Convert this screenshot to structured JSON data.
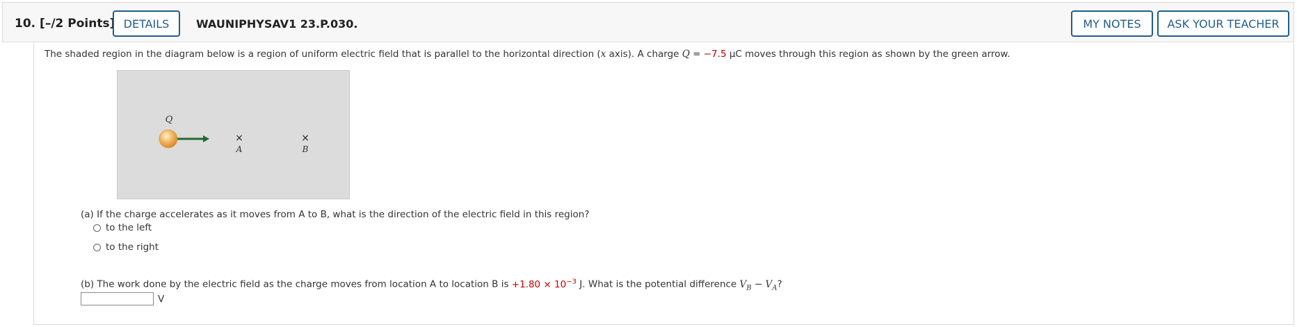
{
  "header": {
    "question_number": "10.",
    "points": "[–/2 Points]",
    "details_label": "DETAILS",
    "question_code": "WAUNIPHYSAV1 23.P.030.",
    "my_notes_label": "MY NOTES",
    "ask_teacher_label": "ASK YOUR TEACHER"
  },
  "intro": {
    "text_before": "The shaded region in the diagram below is a region of uniform electric field that is parallel to the horizontal direction (",
    "axis_var": "x",
    "text_axis": " axis). A charge ",
    "charge_var": "Q",
    "equals": " = ",
    "charge_value": "−7.5",
    "charge_unit": " µC",
    "text_after": "  moves through this region as shown by the green arrow."
  },
  "diagram": {
    "charge_label": "Q",
    "point_a_label": "A",
    "point_b_label": "B",
    "marker": "×",
    "arrow_color": "#1e6b2e",
    "charge_color": "#f2b35a",
    "region_color": "#dcdcdc"
  },
  "part_a": {
    "prompt": "(a) If the charge accelerates as it moves from A to B, what is the direction of the electric field in this region?",
    "options": [
      "to the left",
      "to the right"
    ]
  },
  "part_b": {
    "prompt_before": "(b) The work done by the electric field as the charge moves from location A to location B is ",
    "work_value": "+1.80 × 10",
    "work_exponent": "−3",
    "prompt_mid": " J. What is the potential difference ",
    "v_b": "V",
    "v_b_sub": "B",
    "minus": " − ",
    "v_a": "V",
    "v_a_sub": "A",
    "prompt_end": "?",
    "input_value": "",
    "unit": "V"
  }
}
